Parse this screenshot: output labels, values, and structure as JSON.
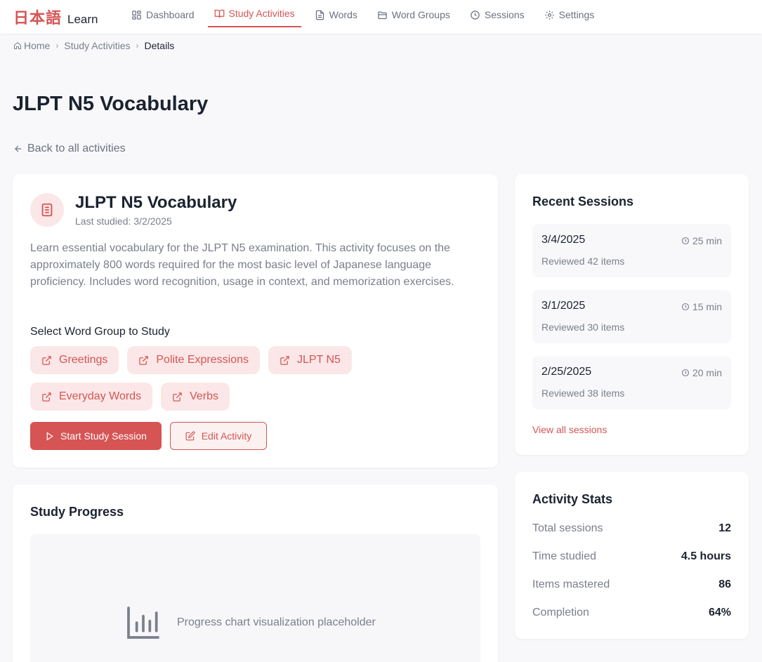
{
  "app": {
    "logo_jp": "日本語",
    "logo_en": "Learn"
  },
  "nav": [
    {
      "label": "Dashboard",
      "icon": "dashboard-icon"
    },
    {
      "label": "Study Activities",
      "icon": "book-open-icon",
      "active": true
    },
    {
      "label": "Words",
      "icon": "file-text-icon"
    },
    {
      "label": "Word Groups",
      "icon": "folder-icon"
    },
    {
      "label": "Sessions",
      "icon": "clock-icon"
    },
    {
      "label": "Settings",
      "icon": "gear-icon"
    }
  ],
  "breadcrumb": {
    "home": "Home",
    "section": "Study Activities",
    "current": "Details"
  },
  "page": {
    "title": "JLPT N5 Vocabulary",
    "back_label": "Back to all activities"
  },
  "activity": {
    "title": "JLPT N5 Vocabulary",
    "last_studied": "Last studied: 3/2/2025",
    "description": "Learn essential vocabulary for the JLPT N5 examination. This activity focuses on the approximately 800 words required for the most basic level of Japanese language proficiency. Includes word recognition, usage in context, and memorization exercises.",
    "word_group_label": "Select Word Group to Study",
    "word_groups": [
      "Greetings",
      "Polite Expressions",
      "JLPT N5",
      "Everyday Words",
      "Verbs"
    ],
    "start_label": "Start Study Session",
    "edit_label": "Edit Activity"
  },
  "progress": {
    "title": "Study Progress",
    "placeholder": "Progress chart visualization placeholder"
  },
  "sessions": {
    "title": "Recent Sessions",
    "items": [
      {
        "date": "3/4/2025",
        "duration": "25 min",
        "reviewed": "Reviewed 42 items"
      },
      {
        "date": "3/1/2025",
        "duration": "15 min",
        "reviewed": "Reviewed 30 items"
      },
      {
        "date": "2/25/2025",
        "duration": "20 min",
        "reviewed": "Reviewed 38 items"
      }
    ],
    "view_all": "View all sessions"
  },
  "stats": {
    "title": "Activity Stats",
    "rows": [
      {
        "label": "Total sessions",
        "value": "12"
      },
      {
        "label": "Time studied",
        "value": "4.5 hours"
      },
      {
        "label": "Items mastered",
        "value": "86"
      },
      {
        "label": "Completion",
        "value": "64%"
      }
    ]
  },
  "colors": {
    "accent": "#d65454",
    "accent_soft": "#fbe7e7",
    "background": "#f8f8fa",
    "text": "#1b2230",
    "muted": "#7a7f8c"
  }
}
